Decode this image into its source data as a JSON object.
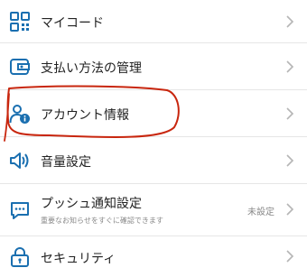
{
  "menu": {
    "items": [
      {
        "label": "マイコード",
        "icon": "qr-code-icon"
      },
      {
        "label": "支払い方法の管理",
        "icon": "wallet-icon"
      },
      {
        "label": "アカウント情報",
        "icon": "account-info-icon"
      },
      {
        "label": "音量設定",
        "icon": "speaker-icon"
      },
      {
        "label": "プッシュ通知設定",
        "sublabel": "重要なお知らせをすぐに確認できます",
        "status": "未設定",
        "icon": "chat-bubble-icon"
      },
      {
        "label": "セキュリティ",
        "icon": "lock-icon"
      }
    ]
  },
  "colors": {
    "icon": "#1a6fb0",
    "chevron": "#b5b5b5",
    "annotation": "#c8260e"
  }
}
